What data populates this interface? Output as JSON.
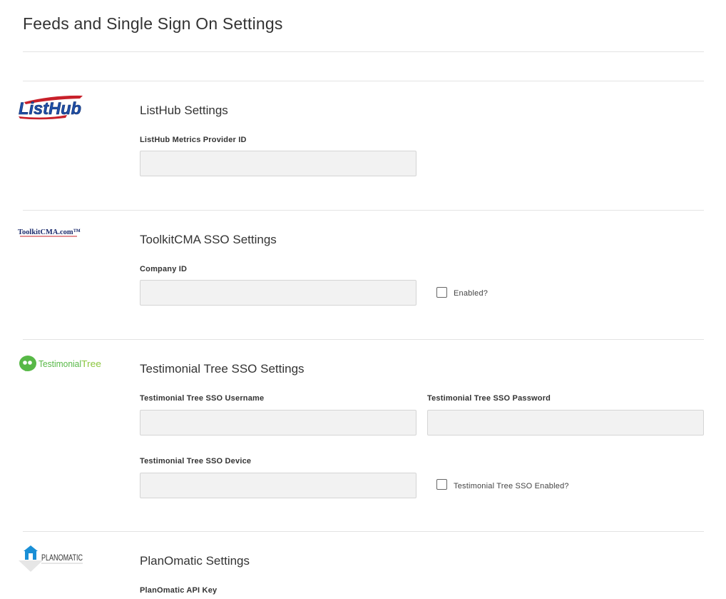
{
  "page": {
    "title": "Feeds and Single Sign On Settings"
  },
  "sections": {
    "listhub": {
      "title": "ListHub Settings",
      "logo_text": "ListHub",
      "metrics_id_label": "ListHub Metrics Provider ID",
      "metrics_id_value": ""
    },
    "toolkit": {
      "title": "ToolkitCMA SSO Settings",
      "logo_text": "ToolkitCMA.com",
      "company_id_label": "Company ID",
      "company_id_value": "",
      "enabled_label": "Enabled?",
      "enabled_checked": false
    },
    "testimonial": {
      "title": "Testimonial Tree SSO Settings",
      "logo_text_a": "Testimonial",
      "logo_text_b": "Tree",
      "username_label": "Testimonial Tree SSO Username",
      "username_value": "",
      "password_label": "Testimonial Tree SSO Password",
      "password_value": "",
      "device_label": "Testimonial Tree SSO Device",
      "device_value": "",
      "enabled_label": "Testimonial Tree SSO Enabled?",
      "enabled_checked": false
    },
    "planomatic": {
      "title": "PlanOmatic Settings",
      "logo_text": "PLANOMATIC",
      "api_key_label": "PlanOmatic API Key"
    }
  },
  "colors": {
    "input_bg": "#f2f2f2",
    "divider": "#e3e3e3",
    "listhub_blue": "#1f4fa8",
    "listhub_red": "#c8202a",
    "testimonial_green": "#57b846",
    "planomatic_blue": "#1a8fd6"
  }
}
